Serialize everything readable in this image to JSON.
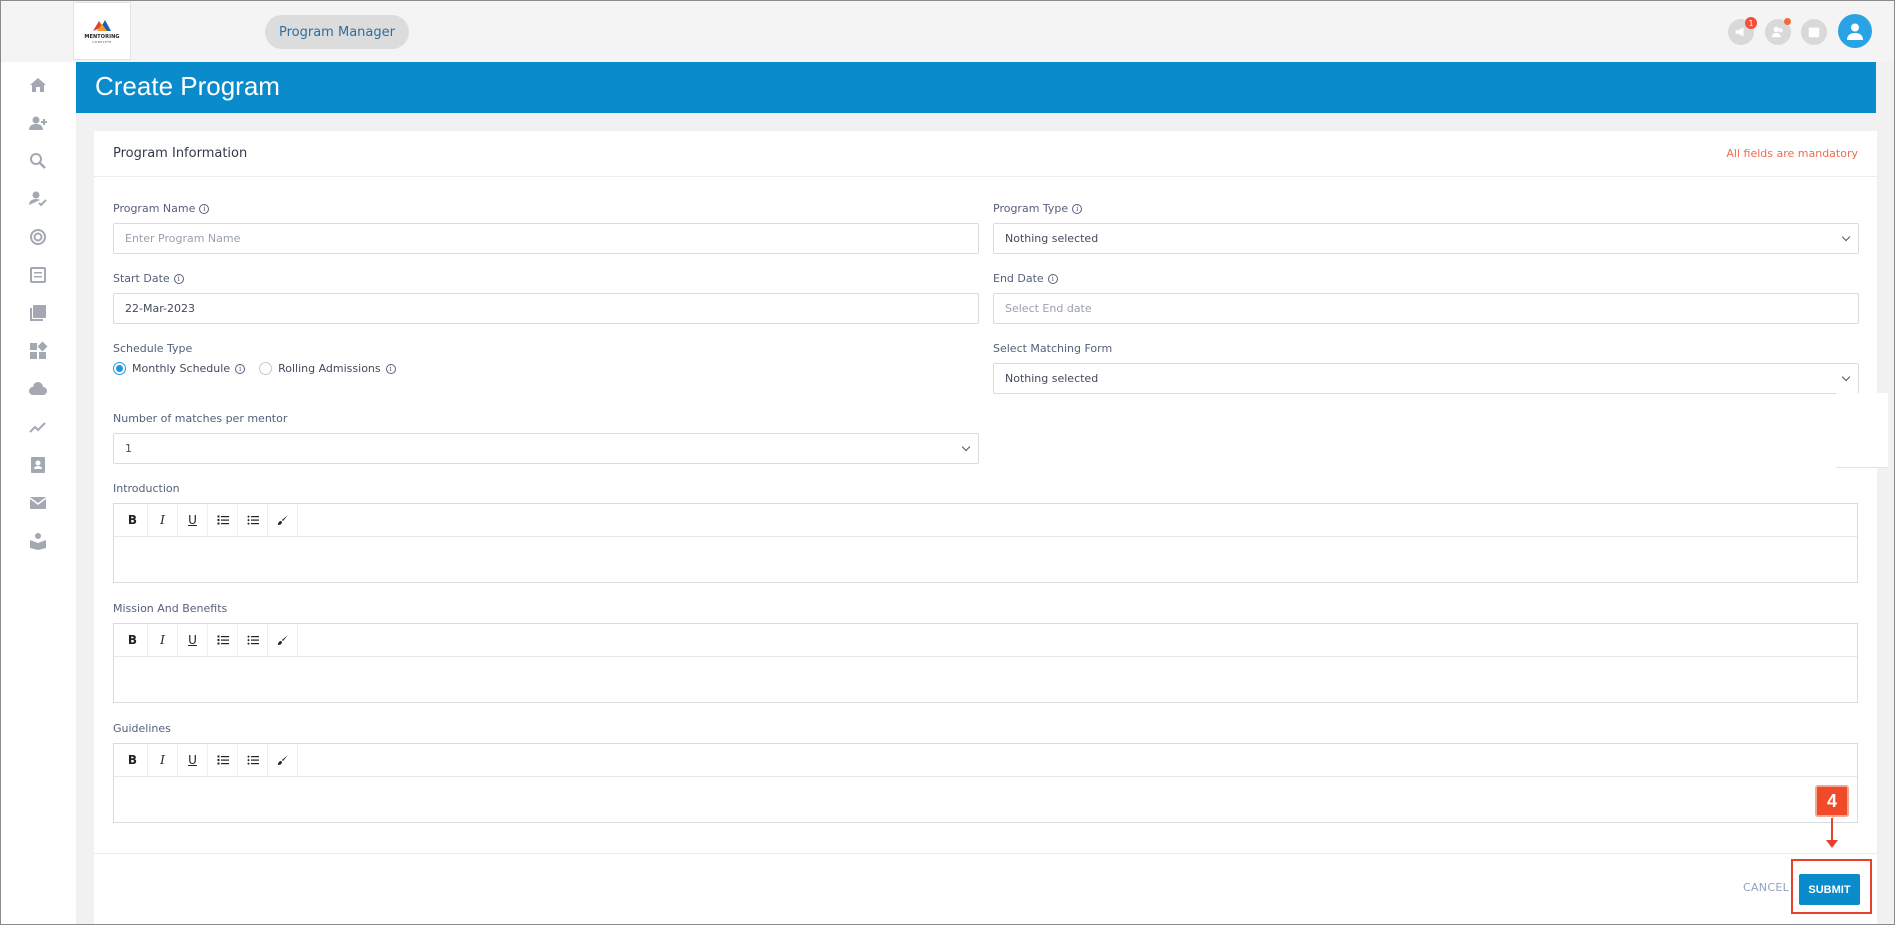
{
  "topbar": {
    "logo_text": "MENTORING",
    "logo_sub": "COMPLETE",
    "role_pill": "Program Manager",
    "notification_count": "1"
  },
  "sidebar": {
    "items": [
      {
        "icon": "home-icon"
      },
      {
        "icon": "add-user-icon"
      },
      {
        "icon": "user-search-icon"
      },
      {
        "icon": "user-check-icon"
      },
      {
        "icon": "target-icon"
      },
      {
        "icon": "list-icon"
      },
      {
        "icon": "library-icon"
      },
      {
        "icon": "widgets-icon"
      },
      {
        "icon": "cloud-download-icon"
      },
      {
        "icon": "trend-icon"
      },
      {
        "icon": "contacts-icon"
      },
      {
        "icon": "mail-icon"
      },
      {
        "icon": "reader-icon"
      }
    ]
  },
  "header": {
    "title": "Create Program"
  },
  "form": {
    "section_title": "Program Information",
    "mandatory_note": "All fields are mandatory",
    "program_name": {
      "label": "Program Name",
      "placeholder": "Enter Program Name"
    },
    "program_type": {
      "label": "Program Type",
      "value": "Nothing selected"
    },
    "start_date": {
      "label": "Start Date",
      "value": "22-Mar-2023"
    },
    "end_date": {
      "label": "End Date",
      "placeholder": "Select End date"
    },
    "schedule_type": {
      "label": "Schedule Type",
      "options": [
        "Monthly Schedule",
        "Rolling Admissions"
      ],
      "selected": "Monthly Schedule"
    },
    "matching_form": {
      "label": "Select Matching Form",
      "value": "Nothing selected"
    },
    "matches_per_mentor": {
      "label": "Number of matches per mentor",
      "value": "1"
    },
    "introduction": {
      "label": "Introduction"
    },
    "mission": {
      "label": "Mission And Benefits"
    },
    "guidelines": {
      "label": "Guidelines"
    },
    "toolbar": {
      "bold": "B",
      "italic": "I",
      "underline": "U"
    }
  },
  "actions": {
    "cancel": "CANCEL",
    "submit": "SUBMIT"
  },
  "callout": {
    "step": "4"
  },
  "colors": {
    "accent": "#0a8bcc",
    "highlight": "#e8412b",
    "mandatory": "#f26b4f"
  }
}
